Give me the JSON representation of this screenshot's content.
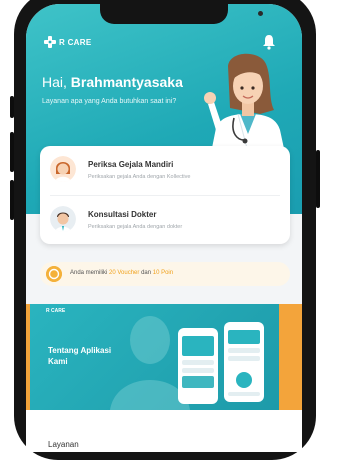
{
  "app": {
    "brand": "R CARE"
  },
  "header": {
    "greeting_prefix": "Hai,",
    "user_name": "Brahmantyasaka",
    "subtitle": "Layanan apa yang Anda butuhkan saat ini?"
  },
  "services": [
    {
      "title": "Periksa Gejala Mandiri",
      "description": "Periksakan gejala Anda dengan Kollective",
      "icon": "female-doctor-avatar-icon"
    },
    {
      "title": "Konsultasi Dokter",
      "description": "Periksakan gejala Anda dengan dokter",
      "icon": "doctor-avatar-icon"
    }
  ],
  "voucher": {
    "prefix": "Anda memiliki",
    "voucher_text": "20 Voucher",
    "middle": "dan",
    "points_text": "10 Poin"
  },
  "banner": {
    "logo": "R CARE",
    "title": "Tentang Aplikasi Kami"
  },
  "section": {
    "title": "Layanan"
  },
  "colors": {
    "primary": "#1fa9b6",
    "accent": "#f3a43b",
    "background": "#f3f5f7"
  }
}
